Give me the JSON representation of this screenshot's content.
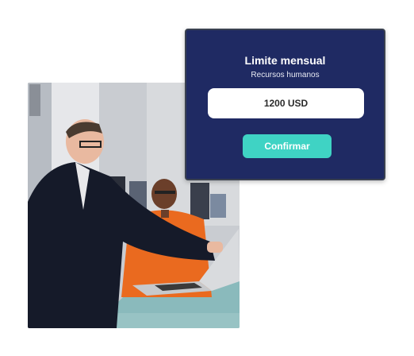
{
  "card": {
    "title": "Limite mensual",
    "subtitle": "Recursos humanos",
    "amount_value": "1200 USD",
    "confirm_label": "Confirmar"
  },
  "photo": {
    "subject": "two-men-with-laptop-photo"
  },
  "colors": {
    "card_background": "#1f2a63",
    "confirm_button": "#3fd3c4",
    "field_background": "#ffffff"
  }
}
